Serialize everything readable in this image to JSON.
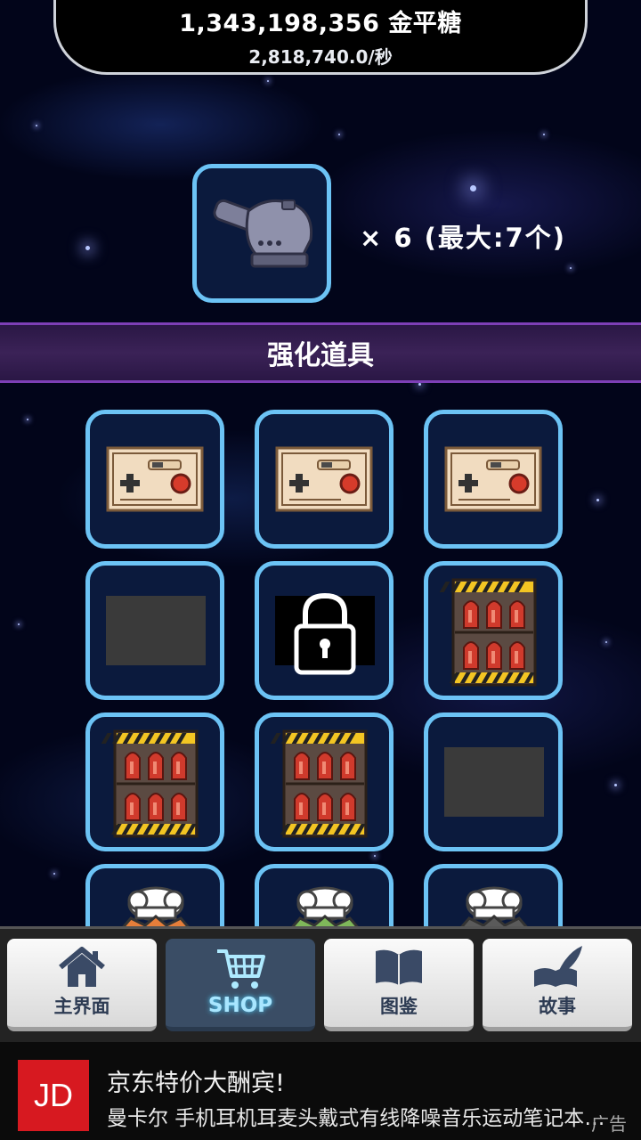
{
  "currency": {
    "amount": "1,343,198,356 金平糖",
    "rate": "2,818,740.0/秒"
  },
  "featured": {
    "icon": "cannon-icon",
    "count_text": "× 6 (最大:7个)"
  },
  "section": {
    "title": "强化道具"
  },
  "grid": [
    {
      "icon": "game-controller-icon"
    },
    {
      "icon": "game-controller-icon"
    },
    {
      "icon": "game-controller-icon"
    },
    {
      "icon": "empty-slot"
    },
    {
      "icon": "lock-icon"
    },
    {
      "icon": "ammo-crate-icon"
    },
    {
      "icon": "ammo-crate-icon"
    },
    {
      "icon": "ammo-crate-icon"
    },
    {
      "icon": "empty-slot"
    },
    {
      "icon": "chef-monster-icon",
      "color": "#e67e3a"
    },
    {
      "icon": "chef-monster-icon",
      "color": "#7fb85a"
    },
    {
      "icon": "chef-monster-icon",
      "color": "#5a5a5a"
    }
  ],
  "nav": {
    "home": "主界面",
    "shop": "SHOP",
    "encyclopedia": "图鉴",
    "story": "故事"
  },
  "ad": {
    "logo": "JD",
    "title": "京东特价大酬宾!",
    "description": "曼卡尔 手机耳机耳麦头戴式有线降噪音乐运动笔记本电脑",
    "tag": "广告"
  }
}
